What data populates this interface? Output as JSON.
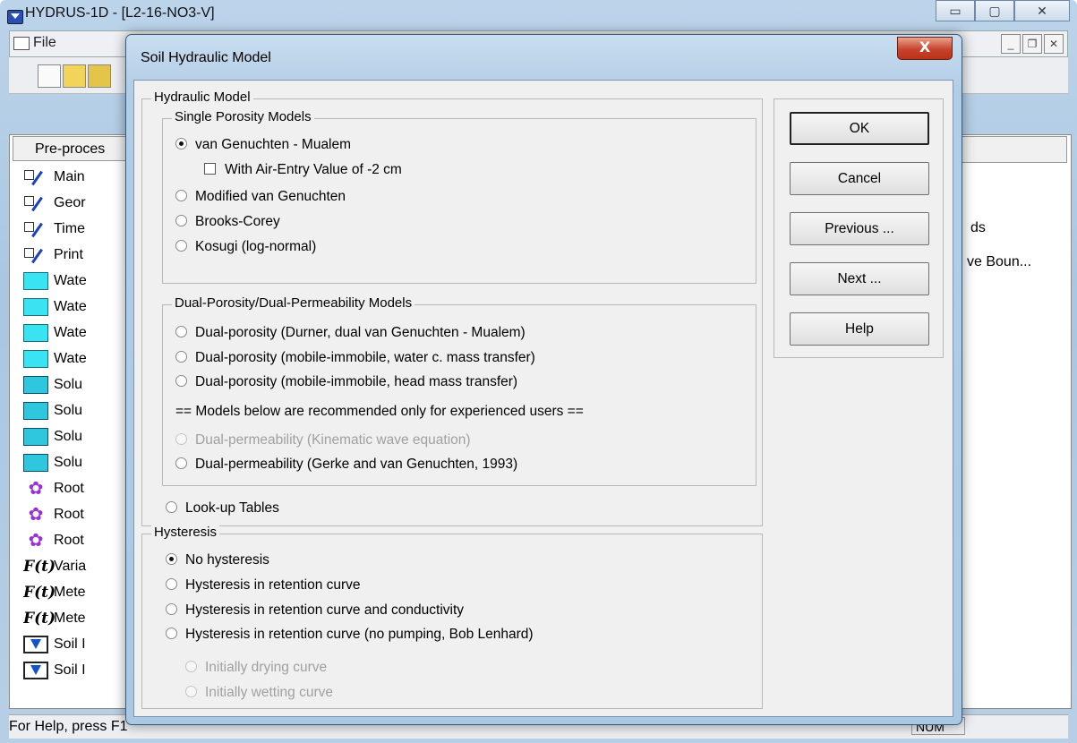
{
  "main_window": {
    "title": "HYDRUS-1D - [L2-16-NO3-V]",
    "menu_file": "File",
    "pane_header": "Pre-proces",
    "tree_items": [
      {
        "label": "Main",
        "icon": "check-pencil-icon"
      },
      {
        "label": "Geor",
        "icon": "check-pencil-icon"
      },
      {
        "label": "Time",
        "icon": "check-pencil-icon"
      },
      {
        "label": "Print",
        "icon": "check-pencil-icon"
      },
      {
        "label": "Wate",
        "icon": "water-icon"
      },
      {
        "label": "Wate",
        "icon": "water-icon"
      },
      {
        "label": "Wate",
        "icon": "water-icon"
      },
      {
        "label": "Wate",
        "icon": "water-icon"
      },
      {
        "label": "Solu",
        "icon": "solute-icon"
      },
      {
        "label": "Solu",
        "icon": "solute-icon"
      },
      {
        "label": "Solu",
        "icon": "solute-icon"
      },
      {
        "label": "Solu",
        "icon": "solute-icon"
      },
      {
        "label": "Root",
        "icon": "root-icon"
      },
      {
        "label": "Root",
        "icon": "root-icon"
      },
      {
        "label": "Root",
        "icon": "root-icon"
      },
      {
        "label": "Varia",
        "icon": "function-icon"
      },
      {
        "label": "Mete",
        "icon": "function-icon"
      },
      {
        "label": "Mete",
        "icon": "function-icon"
      },
      {
        "label": "Soil I",
        "icon": "soil-profile-icon"
      },
      {
        "label": "Soil I",
        "icon": "soil-profile-icon"
      }
    ],
    "right_items": [
      "ds",
      "ve Boun..."
    ],
    "status_text": "For Help, press F1",
    "status_num": "NUM"
  },
  "dialog": {
    "title": "Soil Hydraulic Model",
    "close_label": "X",
    "hydraulic_group": "Hydraulic Model",
    "single_group": "Single Porosity Models",
    "single_options": [
      {
        "label": "van Genuchten - Mualem",
        "checked": true,
        "enabled": true
      },
      {
        "label": "Modified van Genuchten",
        "checked": false,
        "enabled": true
      },
      {
        "label": "Brooks-Corey",
        "checked": false,
        "enabled": true
      },
      {
        "label": "Kosugi (log-normal)",
        "checked": false,
        "enabled": true
      }
    ],
    "air_entry_label": "With Air-Entry Value of -2 cm",
    "air_entry_checked": false,
    "dual_group": "Dual-Porosity/Dual-Permeability Models",
    "dual_options": [
      {
        "label": "Dual-porosity (Durner, dual van Genuchten - Mualem)",
        "checked": false,
        "enabled": true
      },
      {
        "label": "Dual-porosity (mobile-immobile, water c. mass transfer)",
        "checked": false,
        "enabled": true
      },
      {
        "label": "Dual-porosity (mobile-immobile, head mass transfer)",
        "checked": false,
        "enabled": true
      }
    ],
    "experienced_note": "== Models below are recommended only for experienced users ==",
    "dual_perm_options": [
      {
        "label": "Dual-permeability (Kinematic wave equation)",
        "checked": false,
        "enabled": false
      },
      {
        "label": "Dual-permeability (Gerke and van Genuchten, 1993)",
        "checked": false,
        "enabled": true
      }
    ],
    "lookup_label": "Look-up Tables",
    "hysteresis_group": "Hysteresis",
    "hysteresis_options": [
      {
        "label": "No hysteresis",
        "checked": true,
        "enabled": true
      },
      {
        "label": "Hysteresis in retention curve",
        "checked": false,
        "enabled": true
      },
      {
        "label": "Hysteresis in retention curve and conductivity",
        "checked": false,
        "enabled": true
      },
      {
        "label": "Hysteresis in retention curve (no pumping, Bob Lenhard)",
        "checked": false,
        "enabled": true
      }
    ],
    "initial_curve_options": [
      {
        "label": "Initially drying curve",
        "checked": false,
        "enabled": false
      },
      {
        "label": "Initially wetting curve",
        "checked": false,
        "enabled": false
      }
    ],
    "buttons": {
      "ok": "OK",
      "cancel": "Cancel",
      "previous": "Previous ...",
      "next": "Next ...",
      "help": "Help"
    }
  }
}
